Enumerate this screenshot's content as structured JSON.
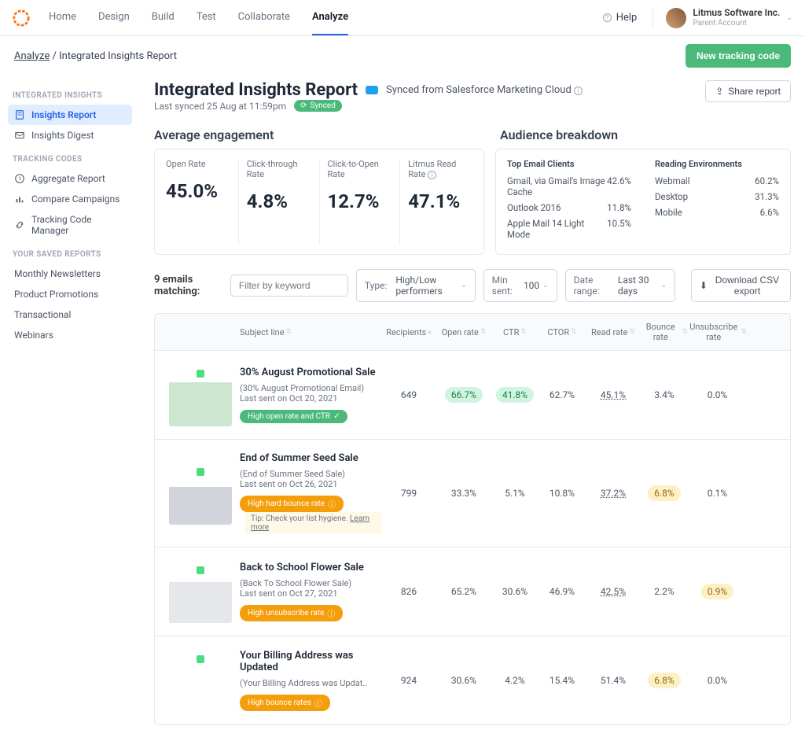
{
  "nav": {
    "tabs": [
      "Home",
      "Design",
      "Build",
      "Test",
      "Collaborate",
      "Analyze"
    ],
    "help": "Help"
  },
  "account": {
    "name": "Litmus Software Inc.",
    "sub": "Parent Account"
  },
  "breadcrumb": {
    "root": "Analyze",
    "current": "Integrated Insights Report"
  },
  "actions": {
    "new_tracking": "New tracking code",
    "share": "Share report",
    "csv": "Download CSV export"
  },
  "sidebar": {
    "sec1": "INTEGRATED INSIGHTS",
    "items1": [
      "Insights Report",
      "Insights Digest"
    ],
    "sec2": "TRACKING CODES",
    "items2": [
      "Aggregate Report",
      "Compare Campaigns",
      "Tracking Code Manager"
    ],
    "sec3": "YOUR SAVED REPORTS",
    "items3": [
      "Monthly Newsletters",
      "Product Promotions",
      "Transactional",
      "Webinars"
    ]
  },
  "page": {
    "title": "Integrated Insights Report",
    "sync_source": "Synced from Salesforce Marketing Cloud",
    "last_synced": "Last synced 25 Aug at 11:59pm",
    "synced_badge": "Synced"
  },
  "sections": {
    "engagement": "Average engagement",
    "audience": "Audience breakdown"
  },
  "metrics": [
    {
      "label": "Open Rate",
      "value": "45.0%"
    },
    {
      "label": "Click-through Rate",
      "value": "4.8%"
    },
    {
      "label": "Click-to-Open Rate",
      "value": "12.7%"
    },
    {
      "label": "Litmus Read Rate",
      "value": "47.1%"
    }
  ],
  "audience": {
    "clients_title": "Top Email Clients",
    "clients": [
      {
        "name": "Gmail, via Gmail's Image Cache",
        "pct": "42.6%"
      },
      {
        "name": "Outlook 2016",
        "pct": "11.8%"
      },
      {
        "name": "Apple Mail 14 Light Mode",
        "pct": "10.5%"
      }
    ],
    "env_title": "Reading Environments",
    "envs": [
      {
        "name": "Webmail",
        "pct": "60.2%"
      },
      {
        "name": "Desktop",
        "pct": "31.3%"
      },
      {
        "name": "Mobile",
        "pct": "6.6%"
      }
    ]
  },
  "filters": {
    "matching": "9 emails matching:",
    "keyword_placeholder": "Filter by keyword",
    "type": {
      "label": "Type:",
      "value": "High/Low performers"
    },
    "min_sent": {
      "label": "Min sent:",
      "value": "100"
    },
    "date_range": {
      "label": "Date range:",
      "value": "Last 30 days"
    }
  },
  "table": {
    "headers": [
      "Subject line",
      "Recipients",
      "Open rate",
      "CTR",
      "CTOR",
      "Read rate",
      "Bounce rate",
      "Unsubscribe rate"
    ],
    "rows": [
      {
        "title": "30% August Promotional Sale",
        "sub": "(30% August Promotional Email)",
        "sent": "Last sent on Oct 20, 2021",
        "tag": "High open rate and CTR",
        "tag_class": "green",
        "recipients": "649",
        "open": "66.7%",
        "open_pill": "green",
        "ctr": "41.8%",
        "ctr_pill": "green",
        "ctor": "62.7%",
        "read": "45.1%",
        "bounce": "3.4%",
        "unsub": "0.0%"
      },
      {
        "title": "End of Summer Seed Sale",
        "sub": "(End of Summer Seed Sale)",
        "sent": "Last sent on Oct 26, 2021",
        "tag": "High hard bounce rate",
        "tag_class": "orange",
        "tip": "Tip: Check your list hygiene.",
        "tip_link": "Learn more",
        "recipients": "799",
        "open": "33.3%",
        "ctr": "5.1%",
        "ctor": "10.8%",
        "read": "37.2%",
        "bounce": "6.8%",
        "bounce_pill": "yellow",
        "unsub": "0.1%"
      },
      {
        "title": "Back to School Flower Sale",
        "sub": "(Back To School Flower Sale)",
        "sent": "Last sent on Oct 27, 2021",
        "tag": "High unsubscribe rate",
        "tag_class": "orange",
        "recipients": "826",
        "open": "65.2%",
        "ctr": "30.6%",
        "ctor": "46.9%",
        "read": "42.5%",
        "bounce": "2.2%",
        "unsub": "0.9%",
        "unsub_pill": "yellow"
      },
      {
        "title": "Your Billing Address was Updated",
        "sub": "(Your Billing Address was Updat..",
        "sent": "",
        "tag": "High bounce rates",
        "tag_class": "orange",
        "recipients": "924",
        "open": "30.6%",
        "ctr": "4.2%",
        "ctor": "15.4%",
        "read": "51.4%",
        "bounce": "6.8%",
        "bounce_pill": "yellow",
        "unsub": "0.0%"
      }
    ]
  }
}
